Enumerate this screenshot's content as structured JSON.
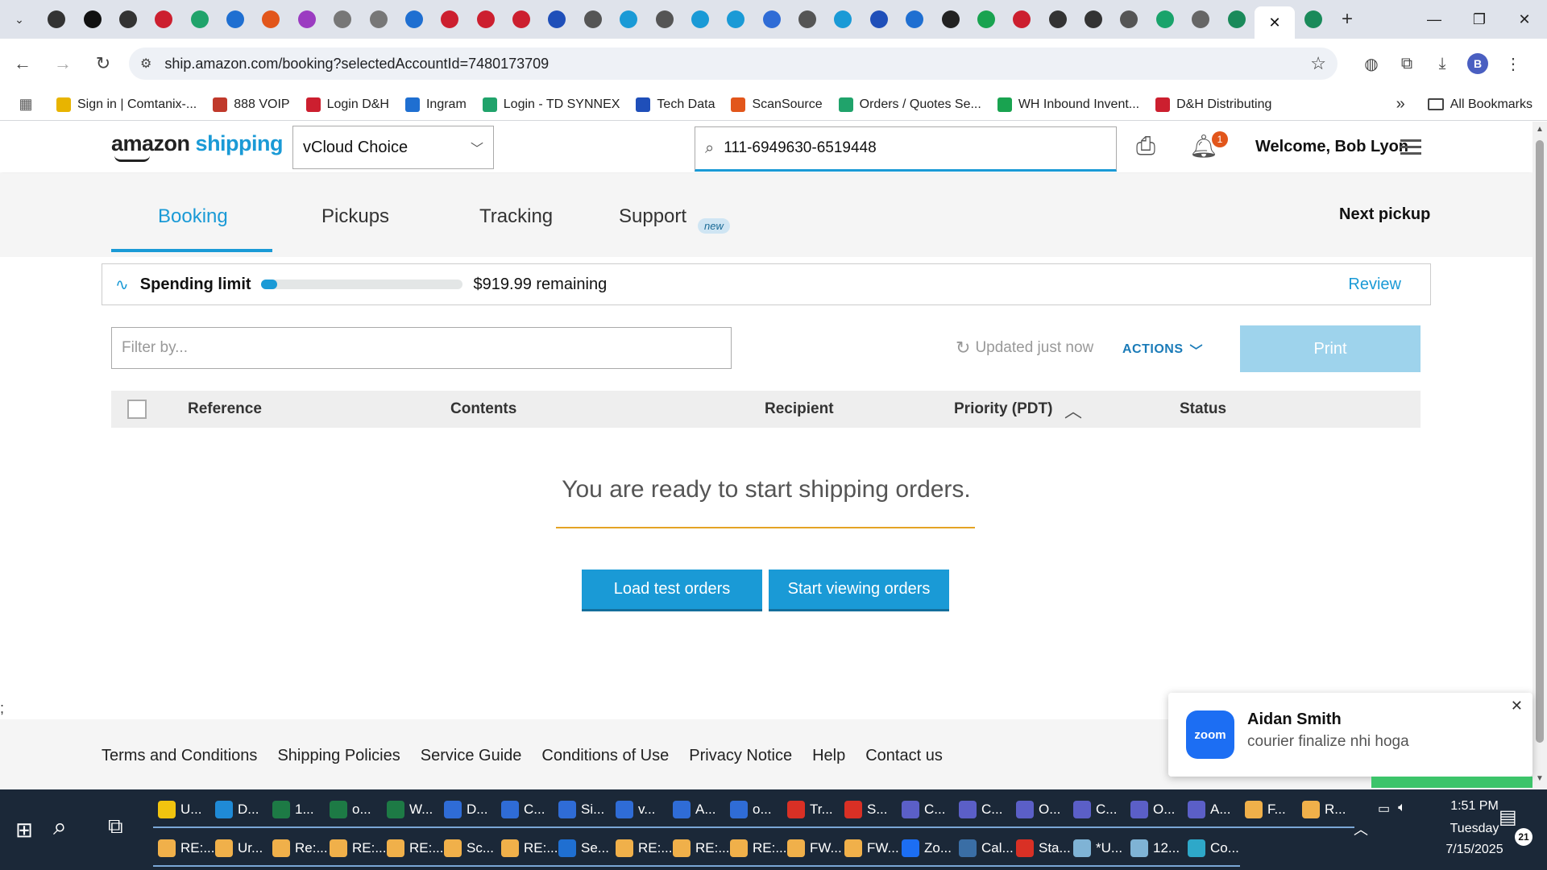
{
  "browser": {
    "tab_icon_colors": [
      "#333333",
      "#111111",
      "#333333",
      "#cc1f2f",
      "#20a36b",
      "#1f6fd1",
      "#e2561b",
      "#9b3cc1",
      "#777777",
      "#777777",
      "#1f6fd1",
      "#cc1f2f",
      "#cc1f2f",
      "#cc1f2f",
      "#1f4fb9",
      "#555555",
      "#1a9ad6",
      "#555555",
      "#1a9ad6",
      "#1a9ad6",
      "#2f6cd6",
      "#555555",
      "#1a9ad6",
      "#1f4fb9",
      "#1f6fd1",
      "#222222",
      "#19a350",
      "#cc1f2f",
      "#333333",
      "#333333",
      "#555555",
      "#1aa36b",
      "#666666",
      "#1a8a5a"
    ],
    "active_tab_icon": "close-icon",
    "url": "ship.amazon.com/booking?selectedAccountId=7480173709",
    "profile_initial": "B"
  },
  "bookmarks": [
    {
      "label": "Sign in | Comtanix-...",
      "color": "#e8b400"
    },
    {
      "label": "888 VOIP",
      "color": "#c0392b"
    },
    {
      "label": "Login D&H",
      "color": "#cc1f2f"
    },
    {
      "label": "Ingram",
      "color": "#1f6fd1"
    },
    {
      "label": "Login - TD SYNNEX",
      "color": "#20a36b"
    },
    {
      "label": "Tech Data",
      "color": "#1f4fb9"
    },
    {
      "label": "ScanSource",
      "color": "#e2561b"
    },
    {
      "label": "Orders / Quotes Se...",
      "color": "#20a36b"
    },
    {
      "label": "WH Inbound Invent...",
      "color": "#19a350"
    },
    {
      "label": "D&H Distributing",
      "color": "#cc1f2f"
    }
  ],
  "all_bookmarks_label": "All Bookmarks",
  "site": {
    "logo_amazon": "amazon",
    "logo_shipping": "shipping",
    "account": "vCloud Choice",
    "search_value": "111-6949630-6519448",
    "welcome": "Welcome, Bob Lyon",
    "notification_count": "1"
  },
  "nav_tabs": {
    "booking": "Booking",
    "pickups": "Pickups",
    "tracking": "Tracking",
    "support": "Support",
    "support_badge": "new",
    "next_pickup": "Next pickup"
  },
  "spending": {
    "label": "Spending limit",
    "used_fraction": 0.08,
    "remaining": "$919.99 remaining",
    "review": "Review"
  },
  "controls": {
    "filter_placeholder": "Filter by...",
    "updated": "Updated just now",
    "actions": "ACTIONS",
    "print": "Print"
  },
  "table": {
    "headers": [
      "Reference",
      "Contents",
      "Recipient",
      "Priority (PDT)",
      "Status"
    ]
  },
  "empty_state": {
    "message": "You are ready to start shipping orders.",
    "load_test": "Load test orders",
    "start_viewing": "Start viewing orders"
  },
  "stray_text": ";",
  "footer": [
    "Terms and Conditions",
    "Shipping Policies",
    "Service Guide",
    "Conditions of Use",
    "Privacy Notice",
    "Help",
    "Contact us"
  ],
  "toast": {
    "app": "zoom",
    "name": "Aidan Smith",
    "message": "courier finalize nhi hoga"
  },
  "taskbar": {
    "row1": [
      {
        "label": "U...",
        "color": "#f1c40f"
      },
      {
        "label": "D...",
        "color": "#1f8ad6"
      },
      {
        "label": "1...",
        "color": "#1d7a45"
      },
      {
        "label": "o...",
        "color": "#1d7a45"
      },
      {
        "label": "W...",
        "color": "#1d7a45"
      },
      {
        "label": "D...",
        "color": "#2f6cd6"
      },
      {
        "label": "C...",
        "color": "#2f6cd6"
      },
      {
        "label": "Si...",
        "color": "#2f6cd6"
      },
      {
        "label": "v...",
        "color": "#2f6cd6"
      },
      {
        "label": "A...",
        "color": "#2f6cd6"
      },
      {
        "label": "o...",
        "color": "#2f6cd6"
      },
      {
        "label": "Tr...",
        "color": "#d93025"
      },
      {
        "label": "S...",
        "color": "#d93025"
      },
      {
        "label": "C...",
        "color": "#5b5fc7"
      },
      {
        "label": "C...",
        "color": "#5b5fc7"
      },
      {
        "label": "O...",
        "color": "#5b5fc7"
      },
      {
        "label": "C...",
        "color": "#5b5fc7"
      },
      {
        "label": "O...",
        "color": "#5b5fc7"
      },
      {
        "label": "A...",
        "color": "#5b5fc7"
      },
      {
        "label": "F...",
        "color": "#f0b04a"
      },
      {
        "label": "R...",
        "color": "#f0b04a"
      }
    ],
    "row2": [
      {
        "label": "RE:...",
        "color": "#f0b04a"
      },
      {
        "label": "Ur...",
        "color": "#f0b04a"
      },
      {
        "label": "Re:...",
        "color": "#f0b04a"
      },
      {
        "label": "RE:...",
        "color": "#f0b04a"
      },
      {
        "label": "RE:...",
        "color": "#f0b04a"
      },
      {
        "label": "Sc...",
        "color": "#f0b04a"
      },
      {
        "label": "RE:...",
        "color": "#f0b04a"
      },
      {
        "label": "Se...",
        "color": "#1f6fd1"
      },
      {
        "label": "RE:...",
        "color": "#f0b04a"
      },
      {
        "label": "RE:...",
        "color": "#f0b04a"
      },
      {
        "label": "RE:...",
        "color": "#f0b04a"
      },
      {
        "label": "FW...",
        "color": "#f0b04a"
      },
      {
        "label": "FW...",
        "color": "#f0b04a"
      },
      {
        "label": "Zo...",
        "color": "#1c6ef3"
      },
      {
        "label": "Cal...",
        "color": "#3a6ea5"
      },
      {
        "label": "Sta...",
        "color": "#d93025"
      },
      {
        "label": "*U...",
        "color": "#7fb3d5"
      },
      {
        "label": "12...",
        "color": "#7fb3d5"
      },
      {
        "label": "Co...",
        "color": "#2ea8c9"
      }
    ],
    "time": "1:51 PM",
    "day": "Tuesday",
    "date": "7/15/2025",
    "notification_count": "21"
  }
}
